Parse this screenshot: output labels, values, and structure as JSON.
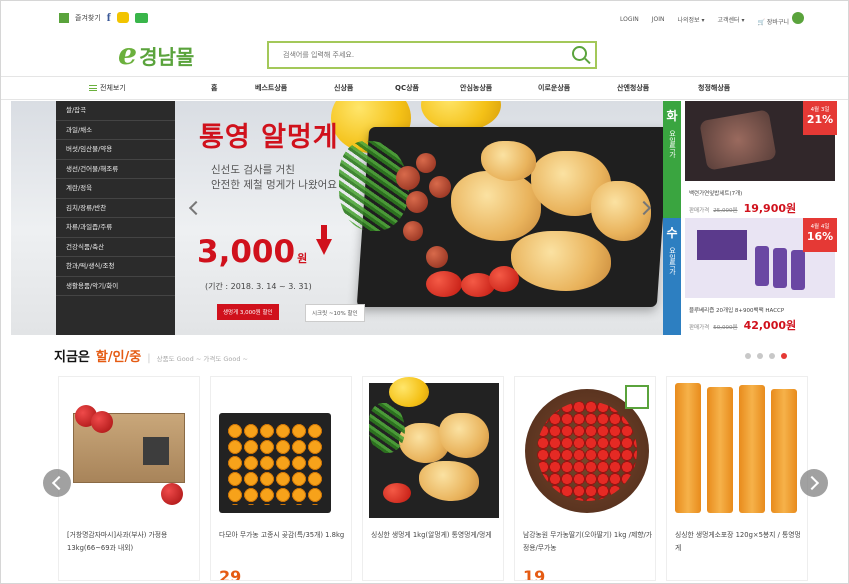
{
  "utility": {
    "bookmark": "즐겨찾기",
    "links_right": [
      "LOGIN",
      "JOIN",
      "나의정보 ▾",
      "고객센터 ▾"
    ],
    "cart": "장바구니"
  },
  "logo": {
    "letter": "e",
    "name": "경남몰"
  },
  "search": {
    "placeholder": "검색어를 입력해 주세요."
  },
  "nav": {
    "all": "전체보기",
    "items": [
      "홈",
      "베스트상품",
      "신상품",
      "QC상품",
      "안심농상품",
      "이로운상품",
      "산엔청상품",
      "청정해상품"
    ]
  },
  "categories": [
    "쌀/잡곡",
    "과일/채소",
    "버섯/임산물/약용",
    "생선/건어물/해조류",
    "계란/정육",
    "김치/장류/반찬",
    "차류/과일즙/주류",
    "건강식품/축산",
    "한과/떡/생식/조청",
    "생활용품/악기/화이"
  ],
  "hero": {
    "title": "통영 알멍게",
    "sub_line1": "신선도 검사를 거친",
    "sub_line2": "안전한 제철 멍게가 나왔어요",
    "price": "3,000",
    "won": "원",
    "period": "(기간 : 2018. 3. 14 ~ 3. 31)",
    "btn_primary": "생멍게 3,000원 할인",
    "btn_secondary": "시크릿 ~10% 할인"
  },
  "daily_deals": [
    {
      "day": "화",
      "day_label": "요일특가",
      "day_color": "#3aa540",
      "tag_date": "4월 3일",
      "tag_pct": "21%",
      "name": "백련가연잎밥세트(7개)",
      "price_label": "판매가격",
      "old_price": "25,000원",
      "price": "19,900원"
    },
    {
      "day": "수",
      "day_label": "요일특가",
      "day_color": "#2d7fc1",
      "tag_date": "4월 4일",
      "tag_pct": "16%",
      "name": "블루베리즙 20개입 8+900백팩 HACCP",
      "price_label": "판매가격",
      "old_price": "50,000원",
      "price": "42,000원"
    }
  ],
  "section": {
    "title_a": "지금은",
    "title_b": "할/인/중",
    "subtitle": "상품도 Good ~ 가격도 Good ~"
  },
  "products": [
    {
      "name": "[거창명감자마시]사과(부사) 가정용 13kg(66~69과 내외)",
      "price": ""
    },
    {
      "name": "다모아 무가농 고종시 곶감(특/35개) 1.8kg",
      "price": "29"
    },
    {
      "name": "싱싱한 생멍게 1kg(알멍게) 통영멍게/멍게",
      "price": ""
    },
    {
      "name": "남강농원 무가농딸기(오아딸기) 1kg /제향/가정용/무가농",
      "price": "19"
    },
    {
      "name": "싱싱한 생멍게소포장 120g×5봉지 / 통영멍게",
      "price": ""
    }
  ],
  "colors": {
    "brand_green": "#5aa33c",
    "accent_red": "#d0111c",
    "accent_orange": "#e55b13"
  }
}
